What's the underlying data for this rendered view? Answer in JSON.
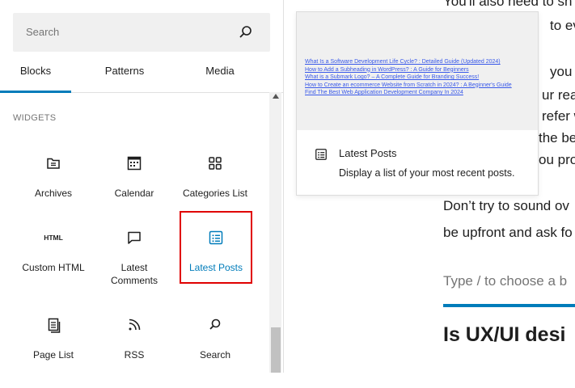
{
  "search": {
    "placeholder": "Search"
  },
  "tabs": [
    {
      "label": "Blocks"
    },
    {
      "label": "Patterns"
    },
    {
      "label": "Media"
    }
  ],
  "section_heading": "WIDGETS",
  "blocks": [
    {
      "label": "Archives",
      "icon": "archive-icon"
    },
    {
      "label": "Calendar",
      "icon": "calendar-icon"
    },
    {
      "label": "Categories List",
      "icon": "categories-icon"
    },
    {
      "label": "Custom HTML",
      "icon": "html-icon",
      "icon_text": "HTML"
    },
    {
      "label": "Latest",
      "label2": "Comments",
      "icon": "comment-icon"
    },
    {
      "label": "Latest Posts",
      "icon": "list-icon"
    },
    {
      "label": "Page List",
      "icon": "pages-icon"
    },
    {
      "label": "RSS",
      "icon": "rss-icon"
    },
    {
      "label": "Search",
      "icon": "search-icon"
    }
  ],
  "content": {
    "lines": [
      "You'll also need to sh",
      "to eva",
      "you th",
      "ur rea",
      "refer w",
      "the be",
      "ou pro",
      "Don’t try to sound ov",
      "be upfront and ask fo"
    ],
    "block_input_placeholder": "Type / to choose a b",
    "heading": "Is UX/UI desi"
  },
  "preview": {
    "links": [
      "What Is a Software Development Life Cycle? : Detailed Guide (Updated 2024)",
      "How to Add a Subheading in WordPress? : A Guide for Beginners",
      "What is a Submark Logo? – A Complete Guide for Branding Success!",
      "How to Create an ecommerce Website from Scratch in 2024? : A Beginner's Guide",
      "Find The Best Web Application Development Company In 2024"
    ],
    "title": "Latest Posts",
    "description": "Display a list of your most recent posts."
  },
  "colors": {
    "accent": "#007cba",
    "highlight_border": "#e00000"
  }
}
